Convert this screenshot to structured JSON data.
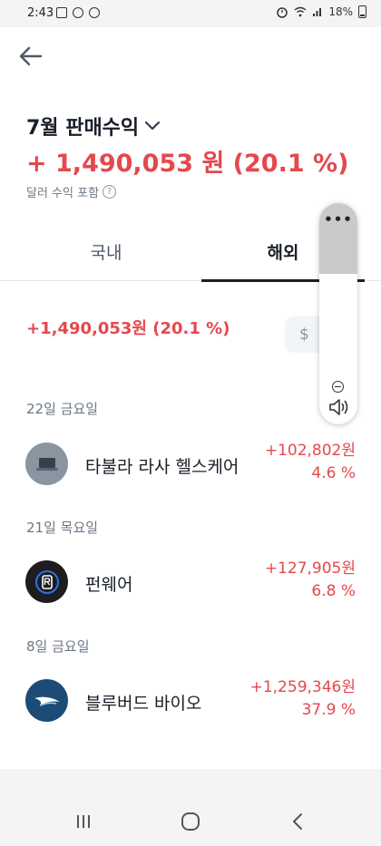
{
  "status_bar": {
    "time": "2:43",
    "battery": "18%"
  },
  "header": {
    "title": "7월 판매수익",
    "total_amount": "+ 1,490,053 원 (20.1 %)",
    "subtitle": "달러 수익 포함"
  },
  "tabs": [
    {
      "label": "국내",
      "selected": false
    },
    {
      "label": "해외",
      "selected": true
    }
  ],
  "summary": {
    "total": "+1,490,053원 (20.1 %)",
    "currency_symbol": "$"
  },
  "groups": [
    {
      "date": "22일 금요일",
      "items": [
        {
          "name": "타불라 라사 헬스케어",
          "amount": "+102,802원",
          "percent": "4.6 %"
        }
      ]
    },
    {
      "date": "21일 목요일",
      "items": [
        {
          "name": "펀웨어",
          "amount": "+127,905원",
          "percent": "6.8 %"
        }
      ]
    },
    {
      "date": "8일 금요일",
      "items": [
        {
          "name": "블루버드 바이오",
          "amount": "+1,259,346원",
          "percent": "37.9 %"
        }
      ]
    }
  ],
  "floating_panel": {
    "menu_icon": "more-dots-icon",
    "zoom_icon": "minus-circle-icon",
    "sound_icon": "speaker-icon"
  },
  "colors": {
    "accent_red": "#e5484d",
    "text_primary": "#191f28",
    "text_secondary": "#6b7684"
  }
}
